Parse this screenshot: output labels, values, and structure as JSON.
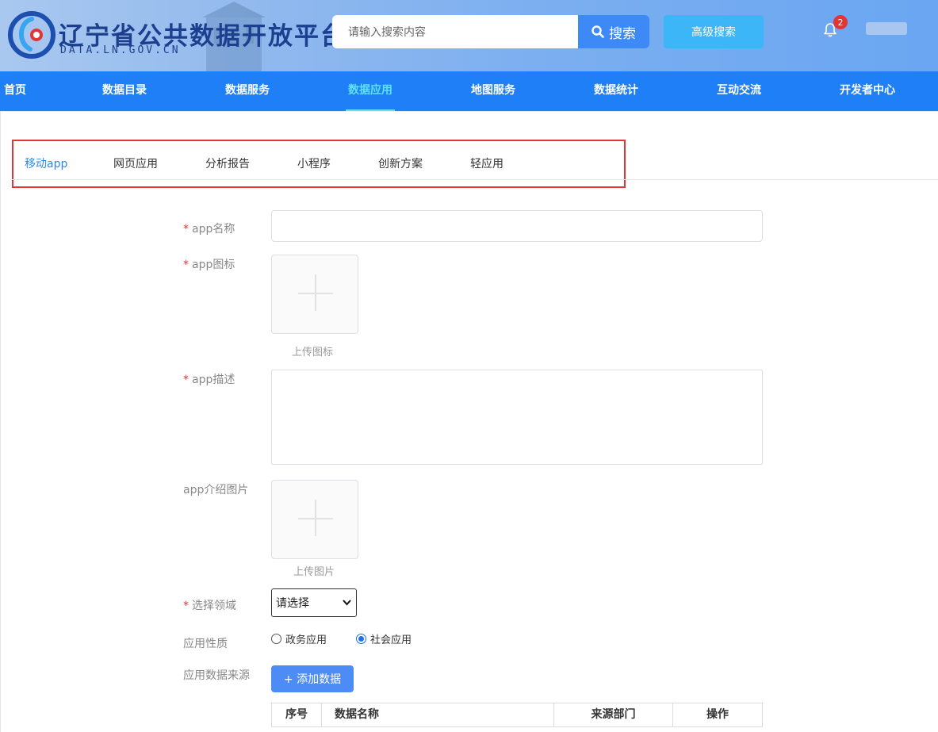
{
  "header": {
    "title": "辽宁省公共数据开放平台",
    "subtitle": "DATA.LN.GOV.CN",
    "search_placeholder": "请输入搜索内容",
    "search_label": "搜索",
    "advanced_search_label": "高级搜索",
    "notification_count": "2"
  },
  "nav": {
    "items": [
      "首页",
      "数据目录",
      "数据服务",
      "数据应用",
      "地图服务",
      "数据统计",
      "互动交流",
      "开发者中心"
    ],
    "active": "数据应用"
  },
  "tabs": {
    "items": [
      "移动app",
      "网页应用",
      "分析报告",
      "小程序",
      "创新方案",
      "轻应用"
    ],
    "active": "移动app"
  },
  "form": {
    "required_mark": "*",
    "app_name_label": "app名称",
    "app_icon_label": "app图标",
    "upload_icon_caption": "上传图标",
    "app_desc_label": "app描述",
    "app_images_label": "app介绍图片",
    "upload_image_caption": "上传图片",
    "domain_label": "选择领域",
    "domain_selected": "请选择",
    "nature_label": "应用性质",
    "nature_options": [
      "政务应用",
      "社会应用"
    ],
    "nature_selected": "社会应用",
    "data_source_label": "应用数据来源",
    "add_data_button": "+ 添加数据"
  },
  "table": {
    "headers": [
      "序号",
      "数据名称",
      "来源部门",
      "操作"
    ]
  },
  "colors": {
    "nav_bg": "#1e7ff6",
    "nav_active": "#5ee1f5",
    "tab_active": "#2f86e8",
    "required": "#e23535",
    "primary_button": "#4d8cf5"
  }
}
